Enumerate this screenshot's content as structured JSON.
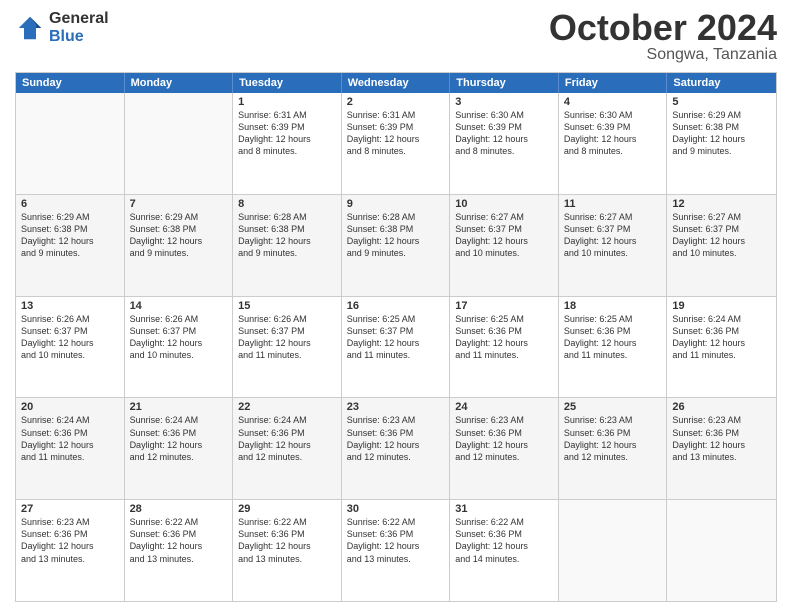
{
  "logo": {
    "general": "General",
    "blue": "Blue"
  },
  "title": "October 2024",
  "subtitle": "Songwa, Tanzania",
  "header_days": [
    "Sunday",
    "Monday",
    "Tuesday",
    "Wednesday",
    "Thursday",
    "Friday",
    "Saturday"
  ],
  "weeks": [
    [
      {
        "day": "",
        "info": "",
        "empty": true
      },
      {
        "day": "",
        "info": "",
        "empty": true
      },
      {
        "day": "1",
        "info": "Sunrise: 6:31 AM\nSunset: 6:39 PM\nDaylight: 12 hours\nand 8 minutes."
      },
      {
        "day": "2",
        "info": "Sunrise: 6:31 AM\nSunset: 6:39 PM\nDaylight: 12 hours\nand 8 minutes."
      },
      {
        "day": "3",
        "info": "Sunrise: 6:30 AM\nSunset: 6:39 PM\nDaylight: 12 hours\nand 8 minutes."
      },
      {
        "day": "4",
        "info": "Sunrise: 6:30 AM\nSunset: 6:39 PM\nDaylight: 12 hours\nand 8 minutes."
      },
      {
        "day": "5",
        "info": "Sunrise: 6:29 AM\nSunset: 6:38 PM\nDaylight: 12 hours\nand 9 minutes."
      }
    ],
    [
      {
        "day": "6",
        "info": "Sunrise: 6:29 AM\nSunset: 6:38 PM\nDaylight: 12 hours\nand 9 minutes."
      },
      {
        "day": "7",
        "info": "Sunrise: 6:29 AM\nSunset: 6:38 PM\nDaylight: 12 hours\nand 9 minutes."
      },
      {
        "day": "8",
        "info": "Sunrise: 6:28 AM\nSunset: 6:38 PM\nDaylight: 12 hours\nand 9 minutes."
      },
      {
        "day": "9",
        "info": "Sunrise: 6:28 AM\nSunset: 6:38 PM\nDaylight: 12 hours\nand 9 minutes."
      },
      {
        "day": "10",
        "info": "Sunrise: 6:27 AM\nSunset: 6:37 PM\nDaylight: 12 hours\nand 10 minutes."
      },
      {
        "day": "11",
        "info": "Sunrise: 6:27 AM\nSunset: 6:37 PM\nDaylight: 12 hours\nand 10 minutes."
      },
      {
        "day": "12",
        "info": "Sunrise: 6:27 AM\nSunset: 6:37 PM\nDaylight: 12 hours\nand 10 minutes."
      }
    ],
    [
      {
        "day": "13",
        "info": "Sunrise: 6:26 AM\nSunset: 6:37 PM\nDaylight: 12 hours\nand 10 minutes."
      },
      {
        "day": "14",
        "info": "Sunrise: 6:26 AM\nSunset: 6:37 PM\nDaylight: 12 hours\nand 10 minutes."
      },
      {
        "day": "15",
        "info": "Sunrise: 6:26 AM\nSunset: 6:37 PM\nDaylight: 12 hours\nand 11 minutes."
      },
      {
        "day": "16",
        "info": "Sunrise: 6:25 AM\nSunset: 6:37 PM\nDaylight: 12 hours\nand 11 minutes."
      },
      {
        "day": "17",
        "info": "Sunrise: 6:25 AM\nSunset: 6:36 PM\nDaylight: 12 hours\nand 11 minutes."
      },
      {
        "day": "18",
        "info": "Sunrise: 6:25 AM\nSunset: 6:36 PM\nDaylight: 12 hours\nand 11 minutes."
      },
      {
        "day": "19",
        "info": "Sunrise: 6:24 AM\nSunset: 6:36 PM\nDaylight: 12 hours\nand 11 minutes."
      }
    ],
    [
      {
        "day": "20",
        "info": "Sunrise: 6:24 AM\nSunset: 6:36 PM\nDaylight: 12 hours\nand 11 minutes."
      },
      {
        "day": "21",
        "info": "Sunrise: 6:24 AM\nSunset: 6:36 PM\nDaylight: 12 hours\nand 12 minutes."
      },
      {
        "day": "22",
        "info": "Sunrise: 6:24 AM\nSunset: 6:36 PM\nDaylight: 12 hours\nand 12 minutes."
      },
      {
        "day": "23",
        "info": "Sunrise: 6:23 AM\nSunset: 6:36 PM\nDaylight: 12 hours\nand 12 minutes."
      },
      {
        "day": "24",
        "info": "Sunrise: 6:23 AM\nSunset: 6:36 PM\nDaylight: 12 hours\nand 12 minutes."
      },
      {
        "day": "25",
        "info": "Sunrise: 6:23 AM\nSunset: 6:36 PM\nDaylight: 12 hours\nand 12 minutes."
      },
      {
        "day": "26",
        "info": "Sunrise: 6:23 AM\nSunset: 6:36 PM\nDaylight: 12 hours\nand 13 minutes."
      }
    ],
    [
      {
        "day": "27",
        "info": "Sunrise: 6:23 AM\nSunset: 6:36 PM\nDaylight: 12 hours\nand 13 minutes."
      },
      {
        "day": "28",
        "info": "Sunrise: 6:22 AM\nSunset: 6:36 PM\nDaylight: 12 hours\nand 13 minutes."
      },
      {
        "day": "29",
        "info": "Sunrise: 6:22 AM\nSunset: 6:36 PM\nDaylight: 12 hours\nand 13 minutes."
      },
      {
        "day": "30",
        "info": "Sunrise: 6:22 AM\nSunset: 6:36 PM\nDaylight: 12 hours\nand 13 minutes."
      },
      {
        "day": "31",
        "info": "Sunrise: 6:22 AM\nSunset: 6:36 PM\nDaylight: 12 hours\nand 14 minutes."
      },
      {
        "day": "",
        "info": "",
        "empty": true
      },
      {
        "day": "",
        "info": "",
        "empty": true
      }
    ]
  ]
}
